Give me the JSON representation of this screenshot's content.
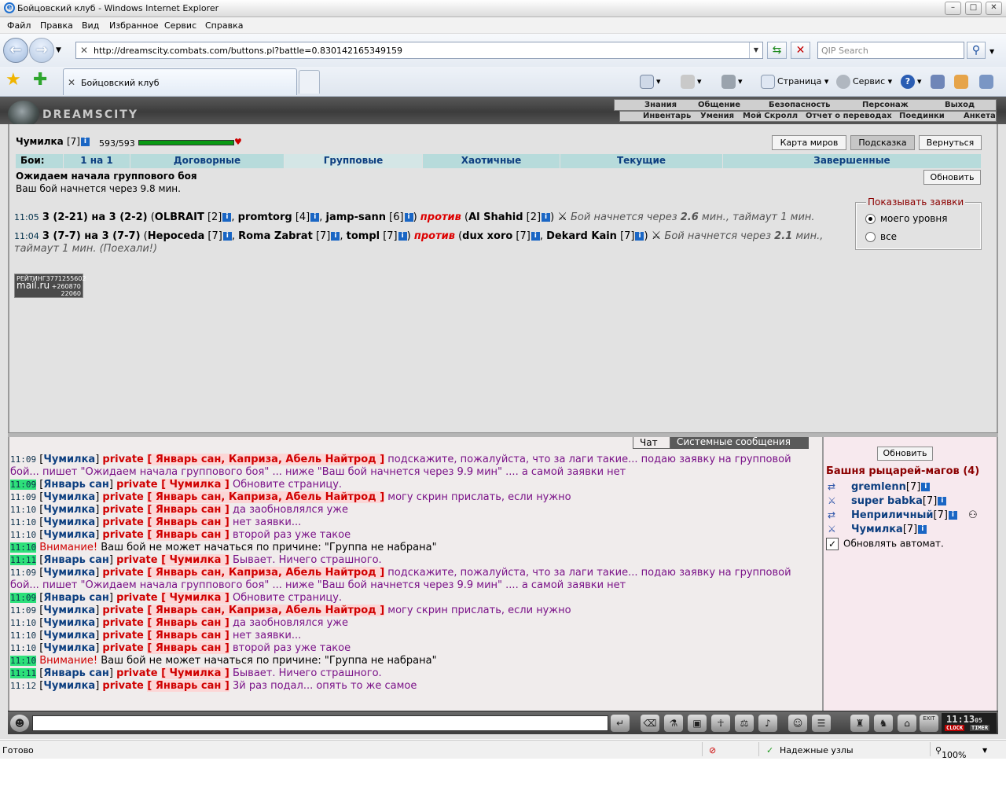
{
  "window": {
    "title": "Бойцовский клуб - Windows Internet Explorer",
    "minimize": "–",
    "maximize": "□",
    "close": "✕"
  },
  "menu": [
    "Файл",
    "Правка",
    "Вид",
    "Избранное",
    "Сервис",
    "Справка"
  ],
  "address": {
    "url": "http://dreamscity.combats.com/buttons.pl?battle=0.830142165349159",
    "search_placeholder": "QIP Search"
  },
  "tab": {
    "label": "Бойцовский клуб"
  },
  "command_bar": {
    "page": "Страница",
    "tools": "Сервис"
  },
  "site": {
    "logo": "DREAMSCITY",
    "top_nav": [
      "Знания",
      "Общение",
      "Безопасность",
      "Персонаж",
      "Выход"
    ],
    "sub_nav": [
      "Инвентарь",
      "Умения",
      "Мой Скролл",
      "Отчет о переводах",
      "Поединки",
      "Анкета"
    ]
  },
  "player": {
    "name": "Чумилка",
    "level": "[7]",
    "hp": "593/593",
    "hp_fraction": 1.0
  },
  "buttons": {
    "world_map": "Карта миров",
    "hint": "Подсказка",
    "back": "Вернуться",
    "refresh": "Обновить"
  },
  "battle_tabs": {
    "label": "Бои:",
    "items": [
      "1 на 1",
      "Договорные",
      "Групповые",
      "Хаотичные",
      "Текущие",
      "Завершенные"
    ],
    "selected": "Групповые"
  },
  "waiting": {
    "title": "Ожидаем начала группового боя",
    "subtitle": "Ваш бой начнется через 9.8 мин."
  },
  "show_requests": {
    "legend": "Показывать заявки",
    "opt1": "моего уровня",
    "opt2": "все"
  },
  "fights": [
    {
      "time": "11:05",
      "counts": "3 (2-21) на 3 (2-2)",
      "team1": [
        {
          "name": "OLBRAIT",
          "lvl": "[2]"
        },
        {
          "name": "promtorg",
          "lvl": "[4]"
        },
        {
          "name": "jamp-sann",
          "lvl": "[6]"
        }
      ],
      "vs": "против",
      "team2": [
        {
          "name": "Al Shahid",
          "lvl": "[2]"
        }
      ],
      "note_pre": "Бой начнется через",
      "minutes": "2.6",
      "note_post": "мин., таймаут 1 мин."
    },
    {
      "time": "11:04",
      "counts": "3 (7-7) на 3 (7-7)",
      "team1": [
        {
          "name": "Hepoceda",
          "lvl": "[7]"
        },
        {
          "name": "Roma Zabrat",
          "lvl": "[7]"
        },
        {
          "name": "tompl",
          "lvl": "[7]"
        }
      ],
      "vs": "против",
      "team2": [
        {
          "name": "dux xoro",
          "lvl": "[7]"
        },
        {
          "name": "Dekard Kain",
          "lvl": "[7]"
        }
      ],
      "note_pre": "Бой начнется через",
      "minutes": "2.1",
      "note_post": "мин., таймаут 1 мин. (Поехали!)"
    }
  ],
  "rating": {
    "line1": "РЕЙТИНГ",
    "num1": "3771255602",
    "brand": "mail.ru",
    "num2": "+260870",
    "num3": "22060"
  },
  "chat_tabs": [
    "Чат",
    "Системные сообщения"
  ],
  "chat": [
    {
      "time": "11:09",
      "hl": false,
      "nick": "Чумилка",
      "to": "Январь сан, Каприза, Абель Найтрод",
      "text": "подскажите, пожалуйста, что за лаги такие... подаю заявку на групповой бой... пишет \"Ожидаем начала группового боя\" ... ниже \"Ваш бой начнется через 9.9 мин\" .... а самой заявки нет"
    },
    {
      "time": "11:09",
      "hl": true,
      "nick": "Январь сан",
      "to": "Чумилка",
      "text": "Обновите страницу."
    },
    {
      "time": "11:09",
      "hl": false,
      "nick": "Чумилка",
      "to": "Январь сан, Каприза, Абель Найтрод",
      "text": "могу скрин прислать, если нужно"
    },
    {
      "time": "11:10",
      "hl": false,
      "nick": "Чумилка",
      "to": "Январь сан",
      "text": "да заобновлялся уже"
    },
    {
      "time": "11:10",
      "hl": false,
      "nick": "Чумилка",
      "to": "Январь сан",
      "text": "нет заявки..."
    },
    {
      "time": "11:10",
      "hl": false,
      "nick": "Чумилка",
      "to": "Январь сан",
      "text": "второй раз уже такое"
    },
    {
      "time": "11:10",
      "hl": true,
      "warn": "Внимание!",
      "text": "Ваш бой не может начаться по причине: \"Группа не набрана\""
    },
    {
      "time": "11:11",
      "hl": true,
      "nick": "Январь сан",
      "to": "Чумилка",
      "text": "Бывает. Ничего страшного."
    },
    {
      "time": "11:09",
      "hl": false,
      "nick": "Чумилка",
      "to": "Январь сан, Каприза, Абель Найтрод",
      "text": "подскажите, пожалуйста, что за лаги такие... подаю заявку на групповой бой... пишет \"Ожидаем начала группового боя\" ... ниже \"Ваш бой начнется через 9.9 мин\" .... а самой заявки нет"
    },
    {
      "time": "11:09",
      "hl": true,
      "nick": "Январь сан",
      "to": "Чумилка",
      "text": "Обновите страницу."
    },
    {
      "time": "11:09",
      "hl": false,
      "nick": "Чумилка",
      "to": "Январь сан, Каприза, Абель Найтрод",
      "text": "могу скрин прислать, если нужно"
    },
    {
      "time": "11:10",
      "hl": false,
      "nick": "Чумилка",
      "to": "Январь сан",
      "text": "да заобновлялся уже"
    },
    {
      "time": "11:10",
      "hl": false,
      "nick": "Чумилка",
      "to": "Январь сан",
      "text": "нет заявки..."
    },
    {
      "time": "11:10",
      "hl": false,
      "nick": "Чумилка",
      "to": "Январь сан",
      "text": "второй раз уже такое"
    },
    {
      "time": "11:10",
      "hl": true,
      "warn": "Внимание!",
      "text": "Ваш бой не может начаться по причине: \"Группа не набрана\""
    },
    {
      "time": "11:11",
      "hl": true,
      "nick": "Январь сан",
      "to": "Чумилка",
      "text": "Бывает. Ничего страшного."
    },
    {
      "time": "11:12",
      "hl": false,
      "nick": "Чумилка",
      "to": "Январь сан",
      "text": "3й раз подал... опять то же самое"
    }
  ],
  "chat_private_word": "private",
  "room": {
    "refresh": "Обновить",
    "title": "Башня рыцарей-магов (4)",
    "people": [
      {
        "name": "gremlenn",
        "lvl": "[7]"
      },
      {
        "name": "super babka",
        "lvl": "[7]"
      },
      {
        "name": "Неприличный",
        "lvl": "[7]"
      },
      {
        "name": "Чумилка",
        "lvl": "[7]"
      }
    ],
    "auto_refresh": "Обновлять автомат."
  },
  "clock": {
    "time": "11:13",
    "sec": "05",
    "clock_label": "CLOCK",
    "timer_label": "TIMER",
    "exit_label": "EXIT"
  },
  "status": {
    "ready": "Готово",
    "zone": "Надежные узлы",
    "zoom": "100%"
  }
}
